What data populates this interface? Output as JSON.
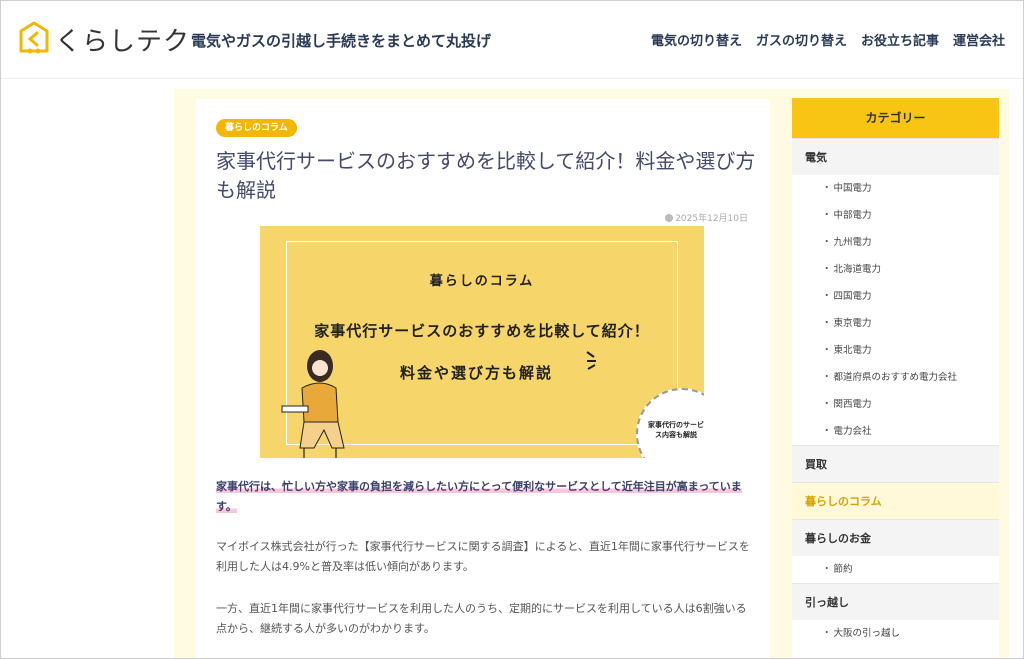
{
  "header": {
    "logo_text": "くらしテク",
    "tagline": "電気やガスの引越し手続きをまとめて丸投げ",
    "nav": [
      "電気の切り替え",
      "ガスの切り替え",
      "お役立ち記事",
      "運営会社"
    ]
  },
  "article": {
    "badge": "暮らしのコラム",
    "title": "家事代行サービスのおすすめを比較して紹介！料金や選び方も解説",
    "date": "2025年12月10日",
    "hero": {
      "sub": "暮らしのコラム",
      "main": "家事代行サービスのおすすめを比較して紹介！",
      "main2": "料金や選び方も解説",
      "circle": "家事代行のサービス内容も解説"
    },
    "lead": "家事代行は、忙しい方や家事の負担を減らしたい方にとって便利なサービスとして近年注目が高まっています。",
    "paragraphs": [
      "マイボイス株式会社が行った【家事代行サービスに関する調査】によると、直近1年間に家事代行サービスを利用した人は4.9%と普及率は低い傾向があります。",
      "一方、直近1年間に家事代行サービスを利用した人のうち、定期的にサービスを利用している人は6割強いる点から、継続する人が多いのがわかります。"
    ]
  },
  "sidebar": {
    "heading": "カテゴリー",
    "groups": [
      {
        "label": "電気",
        "active": false,
        "items": [
          "中国電力",
          "中部電力",
          "九州電力",
          "北海道電力",
          "四国電力",
          "東京電力",
          "東北電力",
          "都道府県のおすすめ電力会社",
          "関西電力",
          "電力会社"
        ]
      },
      {
        "label": "買取",
        "active": false,
        "items": []
      },
      {
        "label": "暮らしのコラム",
        "active": true,
        "items": []
      },
      {
        "label": "暮らしのお金",
        "active": false,
        "items": [
          "節約"
        ]
      },
      {
        "label": "引っ越し",
        "active": false,
        "items": [
          "大阪の引っ越し"
        ]
      }
    ]
  },
  "colors": {
    "accent": "#f8c515",
    "title": "#444a6b",
    "highlight": "#fbc5dc",
    "cream": "#fffbe3"
  }
}
